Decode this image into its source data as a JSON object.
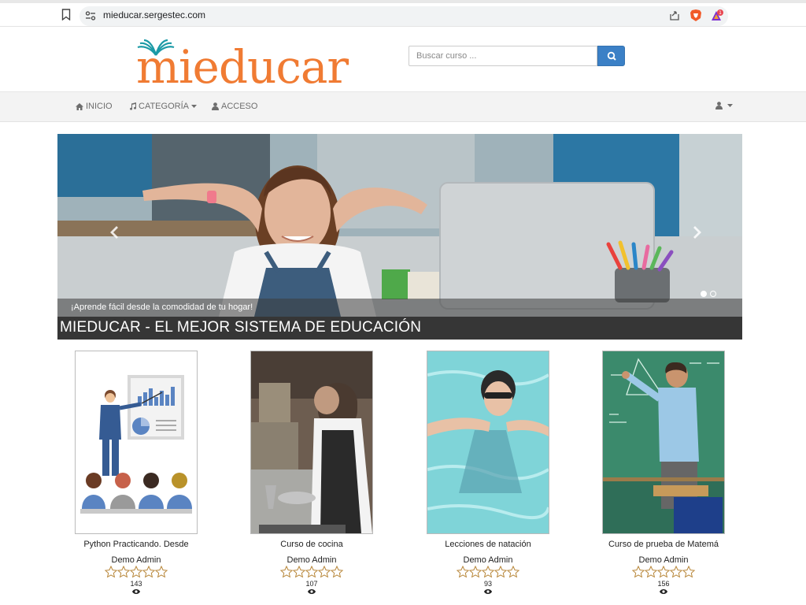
{
  "browser": {
    "url": "mieducar.sergestec.com",
    "notification_count": "1"
  },
  "header": {
    "logo_text": "mieducar",
    "search_placeholder": "Buscar curso ..."
  },
  "nav": {
    "items": [
      {
        "label": "INICIO",
        "icon": "home-icon"
      },
      {
        "label": "CATEGORÍA",
        "icon": "music-icon",
        "dropdown": true
      },
      {
        "label": "ACCESO",
        "icon": "user-icon"
      }
    ]
  },
  "carousel": {
    "caption": "¡Aprende fácil desde la comodidad de tu hogar!",
    "title": "MIEDUCAR - EL MEJOR SISTEMA DE EDUCACIÓN",
    "slide_count": 2,
    "active_slide": 1
  },
  "courses": [
    {
      "title": "Python Practicando. Desde",
      "author": "Demo Admin",
      "rating": 0,
      "views": "143"
    },
    {
      "title": "Curso de cocina",
      "author": "Demo Admin",
      "rating": 0,
      "views": "107"
    },
    {
      "title": "Lecciones de natación",
      "author": "Demo Admin",
      "rating": 0,
      "views": "93"
    },
    {
      "title": "Curso de prueba de Matemá",
      "author": "Demo Admin",
      "rating": 0,
      "views": "156"
    }
  ],
  "colors": {
    "brand_orange": "#f07b33",
    "logo_teal": "#1b9aa6",
    "search_button": "#3b80c6",
    "star_outline": "#b8873a"
  }
}
